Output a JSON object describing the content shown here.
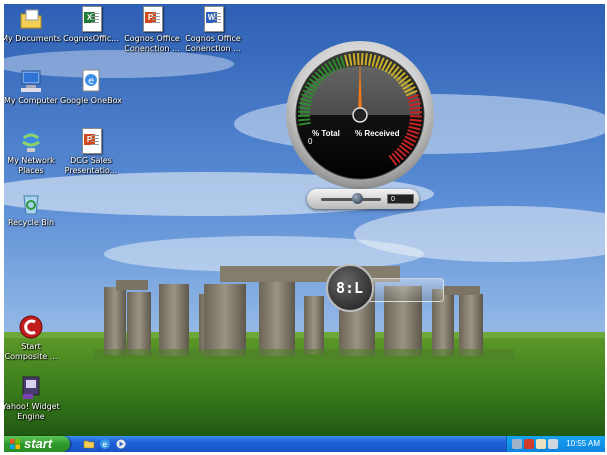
{
  "desktop": {
    "icons": [
      {
        "id": "my-documents",
        "label": "My Documents"
      },
      {
        "id": "cognos-office-1",
        "label": "CognosOffic..."
      },
      {
        "id": "cognos-office-connection-1",
        "label": "Cognos Office Conenction ..."
      },
      {
        "id": "cognos-office-connection-2",
        "label": "Cognos Office Conenction ..."
      },
      {
        "id": "my-computer",
        "label": "My Computer"
      },
      {
        "id": "google-onebox",
        "label": "Google OneBox"
      },
      {
        "id": "my-network-places",
        "label": "My Network Places"
      },
      {
        "id": "dcg-sales",
        "label": "DCG Sales Presentatio..."
      },
      {
        "id": "recycle-bin",
        "label": "Recycle Bin"
      },
      {
        "id": "start-composite",
        "label": "Start Composite ..."
      },
      {
        "id": "yahoo-widget-engine",
        "label": "Yahoo! Widget Engine"
      }
    ]
  },
  "gauge_widget": {
    "label_left": "% Total",
    "label_right": "% Received",
    "value_left": "0",
    "slider_value": "0",
    "needle_percent": 50,
    "colors": {
      "low": "#2e8b2e",
      "mid": "#c9b02a",
      "high": "#c42424",
      "needle": "#f07a1a"
    }
  },
  "clock_widget": {
    "display": "8:L"
  },
  "taskbar": {
    "start_label": "start",
    "quick_launch": [
      "folder-icon",
      "ie-icon",
      "media-icon"
    ],
    "tray_icons": [
      "network-icon",
      "security-icon",
      "volume-icon",
      "printer-icon"
    ],
    "clock": "10:55 AM"
  }
}
